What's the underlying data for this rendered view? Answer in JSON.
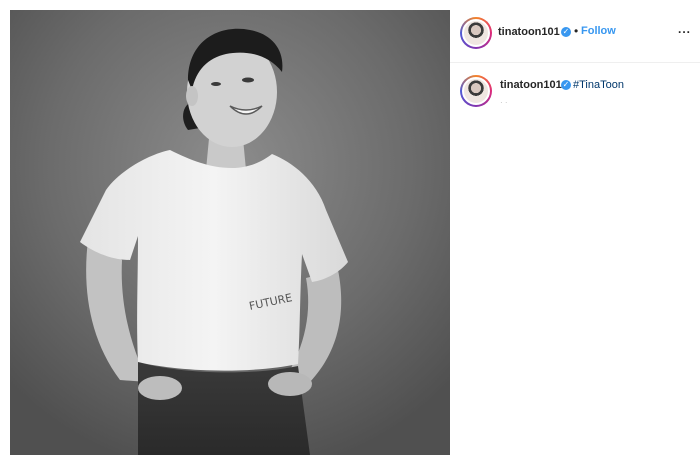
{
  "post": {
    "image_alt": "tinatoon101 post photo"
  },
  "header": {
    "username": "tinatoon101",
    "verified_icon": "✓",
    "separator": "•",
    "follow_label": "Follow",
    "more_label": "..."
  },
  "caption": {
    "username": "tinatoon101",
    "verified_icon": "✓",
    "hashtag": "#TinaToon",
    "faint_text": "· ·"
  },
  "colors": {
    "link_blue": "#3897f0",
    "hashtag_blue": "#00376b",
    "text": "#262626"
  },
  "photo": {
    "shirt_print": "FUTURE"
  }
}
